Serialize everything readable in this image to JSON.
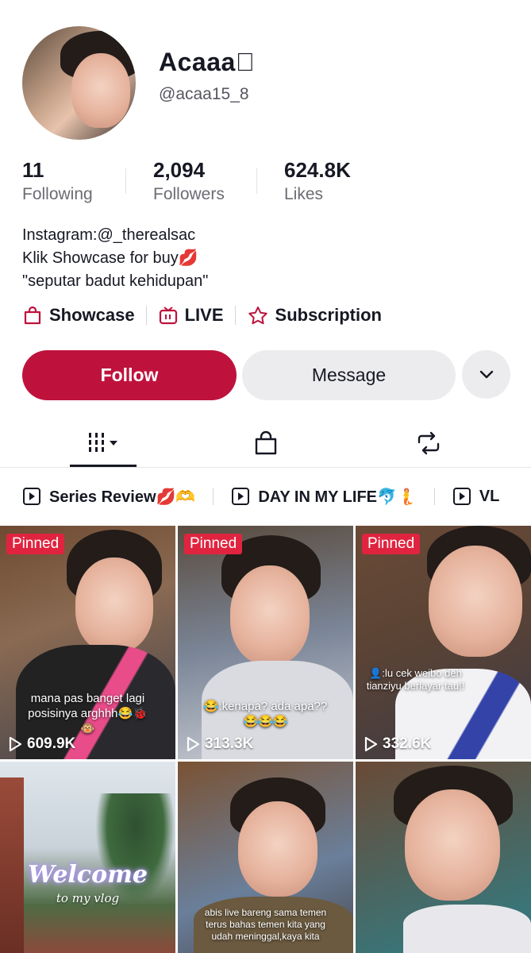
{
  "profile": {
    "name": "Acaaa",
    "handle": "@acaa15_8"
  },
  "stats": [
    {
      "value": "11",
      "label": "Following"
    },
    {
      "value": "2,094",
      "label": "Followers"
    },
    {
      "value": "624.8K",
      "label": "Likes"
    }
  ],
  "bio": {
    "line1": "Instagram:@_therealsac",
    "line2": "Klik Showcase for buy💋",
    "line3": "\"seputar badut kehidupan\""
  },
  "links": {
    "showcase": "Showcase",
    "live": "LIVE",
    "subscription": "Subscription"
  },
  "buttons": {
    "follow": "Follow",
    "message": "Message"
  },
  "tabs": [
    "videos-grid-icon",
    "shop-bag-icon",
    "repost-icon"
  ],
  "playlists": [
    {
      "label": "Series Review💋🫶"
    },
    {
      "label": "DAY IN MY LIFE🐬🧜"
    },
    {
      "label": "VL"
    }
  ],
  "videos": [
    {
      "pinned": "Pinned",
      "views": "609.9K",
      "caption": "mana pas banget lagi posisinya arghhh😂🐞🐵"
    },
    {
      "pinned": "Pinned",
      "views": "313.3K",
      "caption": "😂:kenapa? ada apa??\n😂😂😂"
    },
    {
      "pinned": "Pinned",
      "views": "332.6K",
      "caption": "👤:lu cek weibo deh\ntianziyu berlayar tau!!"
    },
    {
      "overlay": "Welcome",
      "overlay_sub": "to my vlog"
    },
    {
      "caption": "abis live bareng sama temen\nterus bahas temen kita yang\nudah meninggal,kaya kita"
    },
    {}
  ],
  "colors": {
    "accent": "#be123c",
    "pinned": "#e0243f"
  }
}
